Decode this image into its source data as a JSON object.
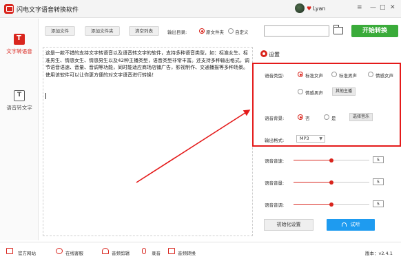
{
  "window": {
    "title": "闪电文字语音转换软件",
    "username": "Lyan",
    "controls": {
      "menu": "≡",
      "minimize": "—",
      "maximize": "□",
      "close": "✕"
    }
  },
  "sidebar": {
    "items": [
      {
        "label": "文字转语音",
        "icon": "text-to-speech-icon",
        "active": true
      },
      {
        "label": "语音转文字",
        "icon": "speech-to-text-icon",
        "active": false
      }
    ]
  },
  "toolbar": {
    "add_file": "添加文件",
    "add_folder": "添加文件夹",
    "clear_list": "清空列表",
    "output_dir_label": "输出目录:",
    "output_option_original": "原文件夹",
    "output_option_custom": "自定义",
    "output_path": "",
    "start_label": "开始转换"
  },
  "editor": {
    "text": "这是一款不错的支持文字转语音以及语音转文字的软件，支持多种语音类型，如：标准女生、标准男生、情感女生、情感男生以及42种主播类型，语音类型非常丰富。还支持多种输出格式，调节语音语速、音量、音调等功能，同时能适应商场店铺广告，影视制作、交通播报等多种场景。使用该软件可以让你更方便的对文字语音进行转换！"
  },
  "settings": {
    "title": "设置",
    "voice_type_label": "语音类型:",
    "voice_types": [
      "标准女声",
      "标准男声",
      "情感女声",
      "情感男声"
    ],
    "voice_type_selected": "标准女声",
    "other_anchor_button": "其他主播",
    "background_label": "语音背景:",
    "background_no": "否",
    "background_yes": "是",
    "background_selected": "否",
    "choose_music_button": "选择音乐",
    "format_label": "输出格式:",
    "format_value": "MP3",
    "speed_label": "语音音速:",
    "speed_value": "5",
    "volume_label": "语音音量:",
    "volume_value": "5",
    "pitch_label": "语音音调:",
    "pitch_value": "5",
    "slider_level_fraction": 0.5,
    "init_button": "初始化设置",
    "listen_button": "试听"
  },
  "footer": {
    "items": [
      "官方网站",
      "在线客服",
      "音频剪辑",
      "录音",
      "音频转换"
    ],
    "version": "版本：v2.4.1"
  },
  "colors": {
    "accent": "#d9251d",
    "highlight_box": "#e41a1a",
    "start_button": "#3aab3a",
    "listen_button": "#1e9bf0"
  }
}
